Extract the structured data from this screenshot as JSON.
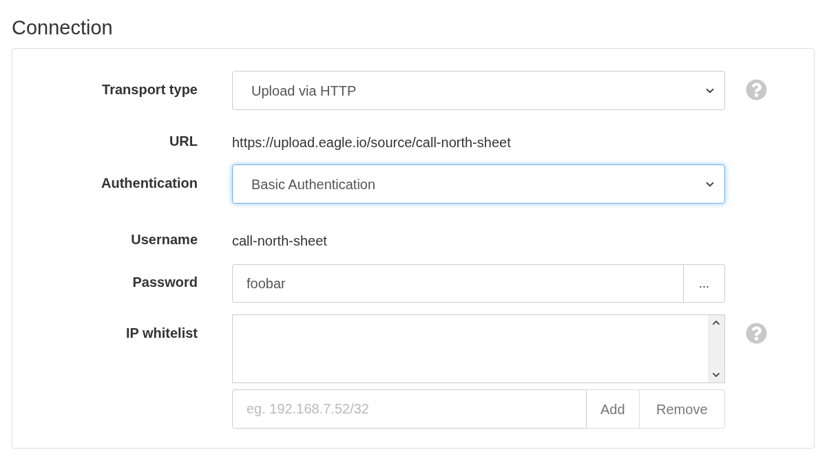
{
  "title": "Connection",
  "rows": [
    {
      "kind": "select",
      "label": "Transport type",
      "value": "Upload via HTTP",
      "focused": false,
      "help": true
    },
    {
      "kind": "text",
      "label": "URL",
      "value": "https://upload.eagle.io/source/call-north-sheet",
      "help": false
    },
    {
      "kind": "select",
      "label": "Authentication",
      "value": "Basic Authentication",
      "focused": true,
      "help": false
    },
    {
      "kind": "text",
      "label": "Username",
      "value": "call-north-sheet",
      "help": false
    },
    {
      "kind": "password",
      "label": "Password",
      "value": "foobar",
      "button": "...",
      "help": false
    },
    {
      "kind": "list",
      "label": "IP whitelist",
      "placeholder": "eg. 192.168.7.52/32",
      "buttons": [
        "Add",
        "Remove"
      ],
      "help": true
    }
  ]
}
